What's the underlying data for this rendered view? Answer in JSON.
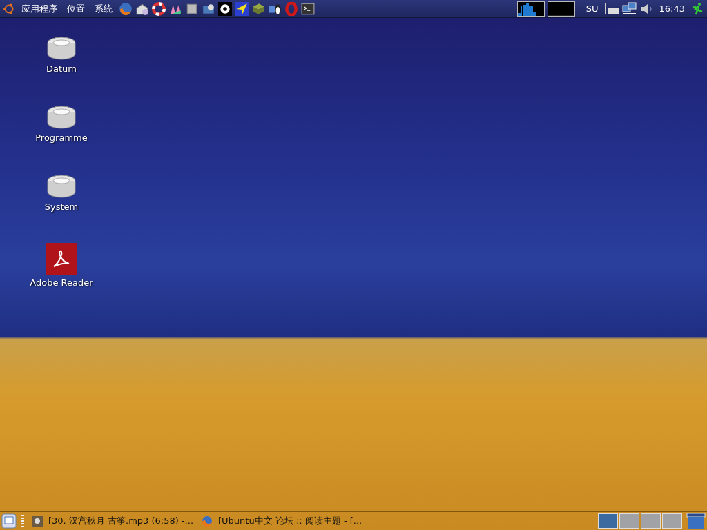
{
  "top_panel": {
    "menus": [
      "应用程序",
      "位置",
      "系统"
    ],
    "keyboard_layout": "SU",
    "clock": "16:43"
  },
  "desktop_icons": [
    {
      "label": "Datum",
      "kind": "drive"
    },
    {
      "label": "Programme",
      "kind": "drive"
    },
    {
      "label": "System",
      "kind": "drive"
    },
    {
      "label": "Adobe Reader",
      "kind": "pdf"
    }
  ],
  "bottom_panel": {
    "tasks": [
      {
        "label": "[30. 汉宫秋月 古筝.mp3 (6:58) -...",
        "kind": "player"
      },
      {
        "label": "[Ubuntu中文 论坛 :: 阅读主题 - [...",
        "kind": "browser"
      }
    ],
    "workspaces": [
      {
        "selected": true
      },
      {
        "selected": false
      },
      {
        "selected": false
      },
      {
        "selected": false
      }
    ]
  }
}
